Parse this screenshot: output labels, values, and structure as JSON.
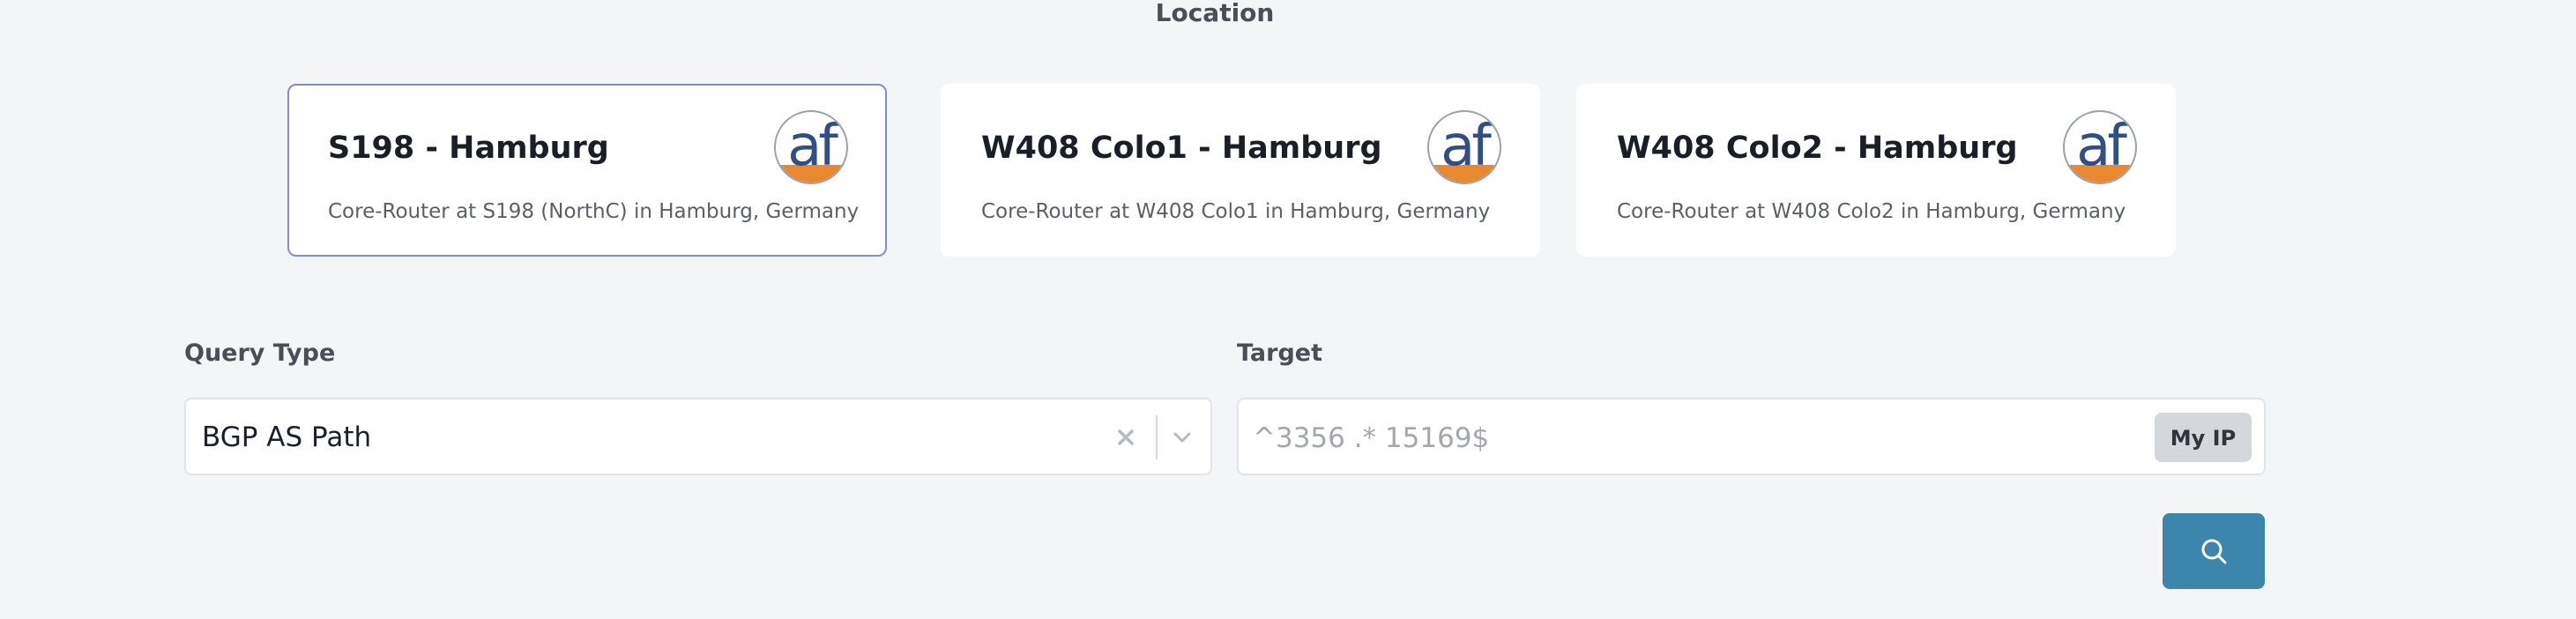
{
  "location": {
    "title": "Location",
    "cards": [
      {
        "title": "S198 - Hamburg",
        "description": "Core-Router at S198 (NorthC) in Hamburg, Germany",
        "logo_icon": "af-logo-icon",
        "selected": true
      },
      {
        "title": "W408 Colo1 - Hamburg",
        "description": "Core-Router at W408 Colo1 in Hamburg, Germany",
        "logo_icon": "af-logo-icon",
        "selected": false
      },
      {
        "title": "W408 Colo2 - Hamburg",
        "description": "Core-Router at W408 Colo2 in Hamburg, Germany",
        "logo_icon": "af-logo-icon",
        "selected": false
      }
    ]
  },
  "query_type": {
    "label": "Query Type",
    "value": "BGP AS Path",
    "clear_icon": "close-icon",
    "dropdown_icon": "chevron-down-icon"
  },
  "target": {
    "label": "Target",
    "value": "",
    "placeholder": "^3356 .* 15169$",
    "my_ip_label": "My IP"
  },
  "submit": {
    "icon": "search-icon"
  },
  "colors": {
    "background": "#f4f5f7",
    "selected_border": "#7e8fd0",
    "submit_button": "#3c86ae",
    "my_ip_button": "#d4d7dc",
    "logo_blue": "#2f4f86",
    "logo_orange": "#e8892f"
  }
}
